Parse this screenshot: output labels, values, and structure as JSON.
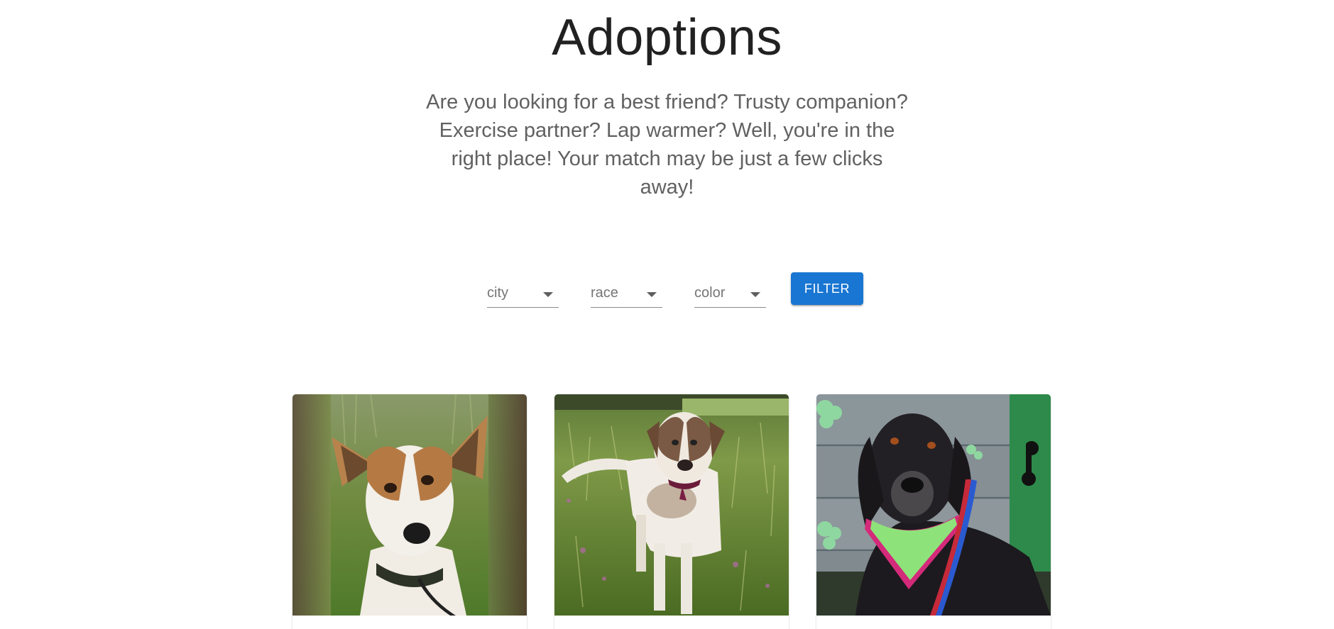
{
  "header": {
    "title": "Adoptions",
    "subtitle": "Are you looking for a best friend? Trusty companion? Exercise partner? Lap warmer? Well, you're in the right place! Your match may be just a few clicks away!"
  },
  "filters": {
    "city_label": "city",
    "race_label": "race",
    "color_label": "color",
    "button_label": "FILTER",
    "button_color": "#1976d2"
  },
  "cards": [
    {
      "photo": "jack-russell-dog-photo"
    },
    {
      "photo": "spotted-white-dog-in-field-photo"
    },
    {
      "photo": "black-dog-with-green-bandana-photo"
    }
  ]
}
